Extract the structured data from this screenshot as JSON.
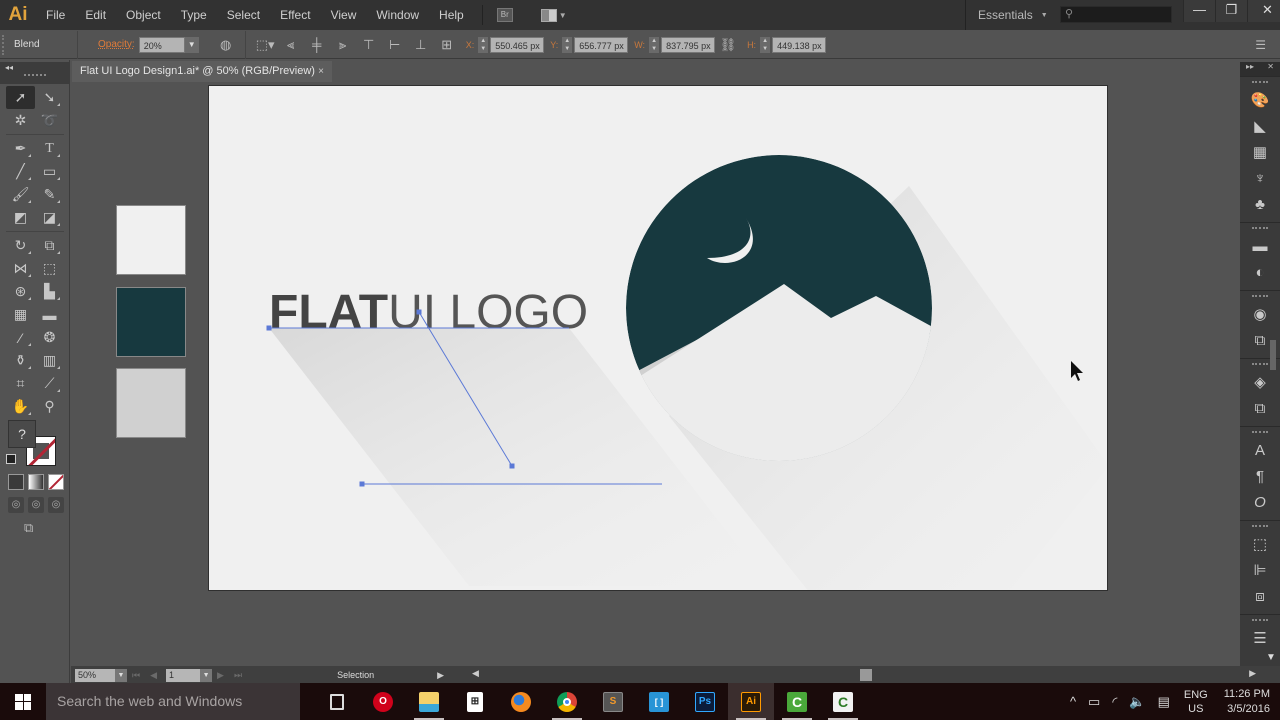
{
  "app": {
    "logo": "Ai",
    "bridge_label": "Br"
  },
  "menu": [
    "File",
    "Edit",
    "Object",
    "Type",
    "Select",
    "Effect",
    "View",
    "Window",
    "Help"
  ],
  "workspace": {
    "label": "Essentials"
  },
  "search": {
    "placeholder": ""
  },
  "window_controls": {
    "minimize": "—",
    "restore": "❐",
    "close": "✕"
  },
  "control_bar": {
    "selection_type": "Blend",
    "opacity_label": "Opacity:",
    "opacity_value": "20%",
    "x_label": "X:",
    "x_value": "550.465 px",
    "y_label": "Y:",
    "y_value": "656.777 px",
    "w_label": "W:",
    "w_value": "837.795 px",
    "h_label": "H:",
    "h_value": "449.138 px"
  },
  "document": {
    "tab_title": "Flat UI Logo Design1.ai* @ 50% (RGB/Preview)",
    "close": "×"
  },
  "artwork": {
    "title_bold": "FLAT",
    "title_light": "UI LOGO",
    "colors": {
      "background": "#f0f0f0",
      "dark_teal": "#17393f",
      "light_gray": "#d0d0d0",
      "text_gray": "#4a4a4a",
      "selection_blue": "#5b79d6"
    },
    "swatches": [
      "#f0f0f0",
      "#17393f",
      "#d0d0d0"
    ]
  },
  "tools": {
    "fill_unknown": "?"
  },
  "status_bar": {
    "zoom": "50%",
    "page": "1",
    "tool_status": "Selection"
  },
  "taskbar": {
    "search_placeholder": "Search the web and Windows",
    "apps": [
      {
        "name": "task-view",
        "label": ""
      },
      {
        "name": "opera",
        "label": "O"
      },
      {
        "name": "file-explorer",
        "label": ""
      },
      {
        "name": "store",
        "label": ""
      },
      {
        "name": "firefox",
        "label": ""
      },
      {
        "name": "chrome",
        "label": ""
      },
      {
        "name": "sublime",
        "label": "S"
      },
      {
        "name": "brackets",
        "label": "[ ]"
      },
      {
        "name": "photoshop",
        "label": "Ps"
      },
      {
        "name": "illustrator",
        "label": "Ai"
      },
      {
        "name": "camtasia-recorder",
        "label": "C"
      },
      {
        "name": "camtasia-studio",
        "label": "C"
      }
    ],
    "lang_top": "ENG",
    "lang_bottom": "US",
    "time": "11:26 PM",
    "date": "3/5/2016"
  }
}
